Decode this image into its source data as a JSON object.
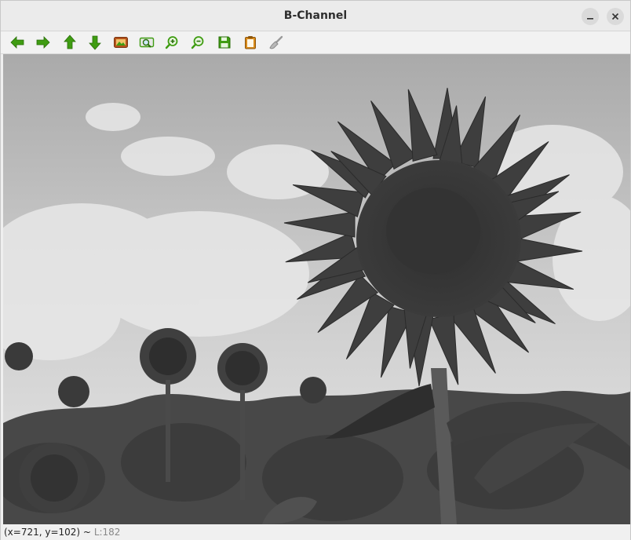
{
  "window": {
    "title": "B-Channel"
  },
  "titlebar_buttons": [
    {
      "name": "minimize-button",
      "icon": "minimize-icon"
    },
    {
      "name": "close-button",
      "icon": "close-icon"
    }
  ],
  "toolbar": {
    "items": [
      {
        "name": "pan-left-button",
        "icon": "arrow-left-icon",
        "color": "#3f9c12"
      },
      {
        "name": "pan-right-button",
        "icon": "arrow-right-icon",
        "color": "#3f9c12"
      },
      {
        "name": "pan-up-button",
        "icon": "arrow-up-icon",
        "color": "#3f9c12"
      },
      {
        "name": "pan-down-button",
        "icon": "arrow-down-icon",
        "color": "#3f9c12"
      },
      {
        "name": "zoom-original-button",
        "icon": "image-icon",
        "color": "#b5531c"
      },
      {
        "name": "zoom-fit-button",
        "icon": "zoom-fit-icon",
        "color": "#3f9c12"
      },
      {
        "name": "zoom-in-button",
        "icon": "zoom-in-icon",
        "color": "#3f9c12"
      },
      {
        "name": "zoom-out-button",
        "icon": "zoom-out-icon",
        "color": "#3f9c12"
      },
      {
        "name": "save-button",
        "icon": "floppy-disk-icon",
        "color": "#3f9c12"
      },
      {
        "name": "copy-clipboard-button",
        "icon": "clipboard-icon",
        "color": "#d88a1a"
      },
      {
        "name": "properties-button",
        "icon": "brush-icon",
        "color": "#9a9a9a"
      }
    ]
  },
  "image": {
    "description_colors": {
      "sky": "#d9d9d9",
      "flower": "#3a3a3a",
      "field": "#454545"
    }
  },
  "status": {
    "coords": "(x=721, y=102) ~",
    "level": "L:182"
  }
}
